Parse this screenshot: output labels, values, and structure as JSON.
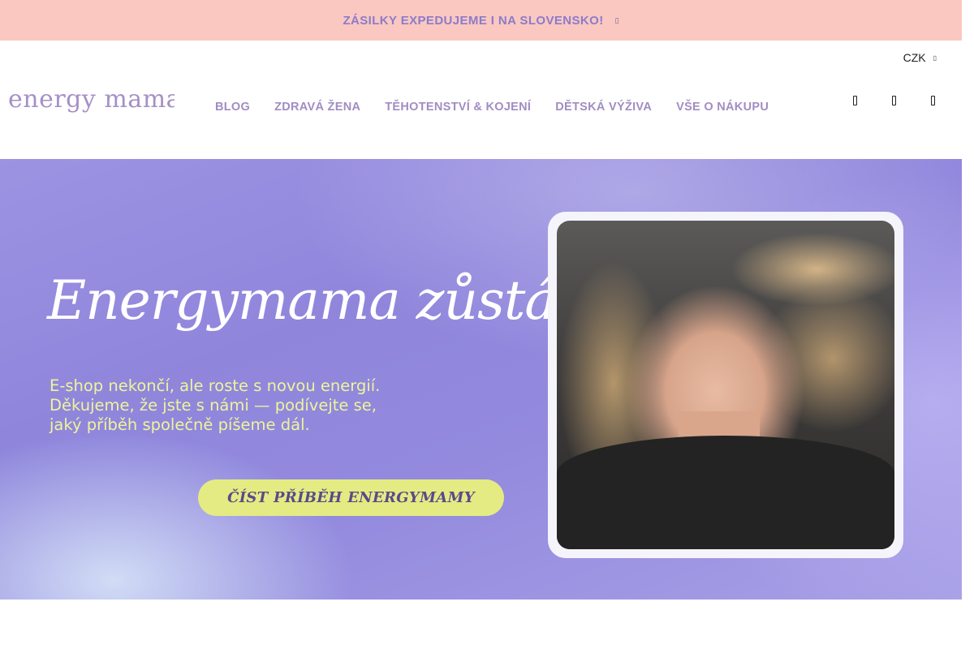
{
  "announcement": {
    "text": "ZÁSILKY EXPEDUJEME I NA SLOVENSKO!",
    "glyph": "▯"
  },
  "header": {
    "currency": "CZK",
    "currency_glyph": "▯",
    "logo_text": "energy mama",
    "nav": [
      {
        "label": "BLOG"
      },
      {
        "label": "ZDRAVÁ ŽENA"
      },
      {
        "label": "TĚHOTENSTVÍ & KOJENÍ"
      },
      {
        "label": "DĚTSKÁ VÝŽIVA"
      },
      {
        "label": "VŠE O NÁKUPU"
      }
    ],
    "icons": [
      "search-icon",
      "account-icon",
      "cart-icon"
    ]
  },
  "hero": {
    "title": "Energymama zůstává",
    "subtitle": [
      "E-shop nekončí, ale roste s novou energií.",
      "Děkujeme, že jste s námi — podívejte se,",
      "jaký příběh společně píšeme dál."
    ],
    "cta": "ČÍST PŘÍBĚH ENERGYMAMY"
  },
  "colors": {
    "announcement_bg": "#fbc7c1",
    "announcement_text": "#8b7cc9",
    "nav_text": "#a18dc2",
    "logo": "#a690c6",
    "hero_bg": "#9d93e3",
    "hero_subtitle": "#eef49a",
    "cta_bg": "#e4eb82",
    "cta_text": "#5a4a8a"
  }
}
